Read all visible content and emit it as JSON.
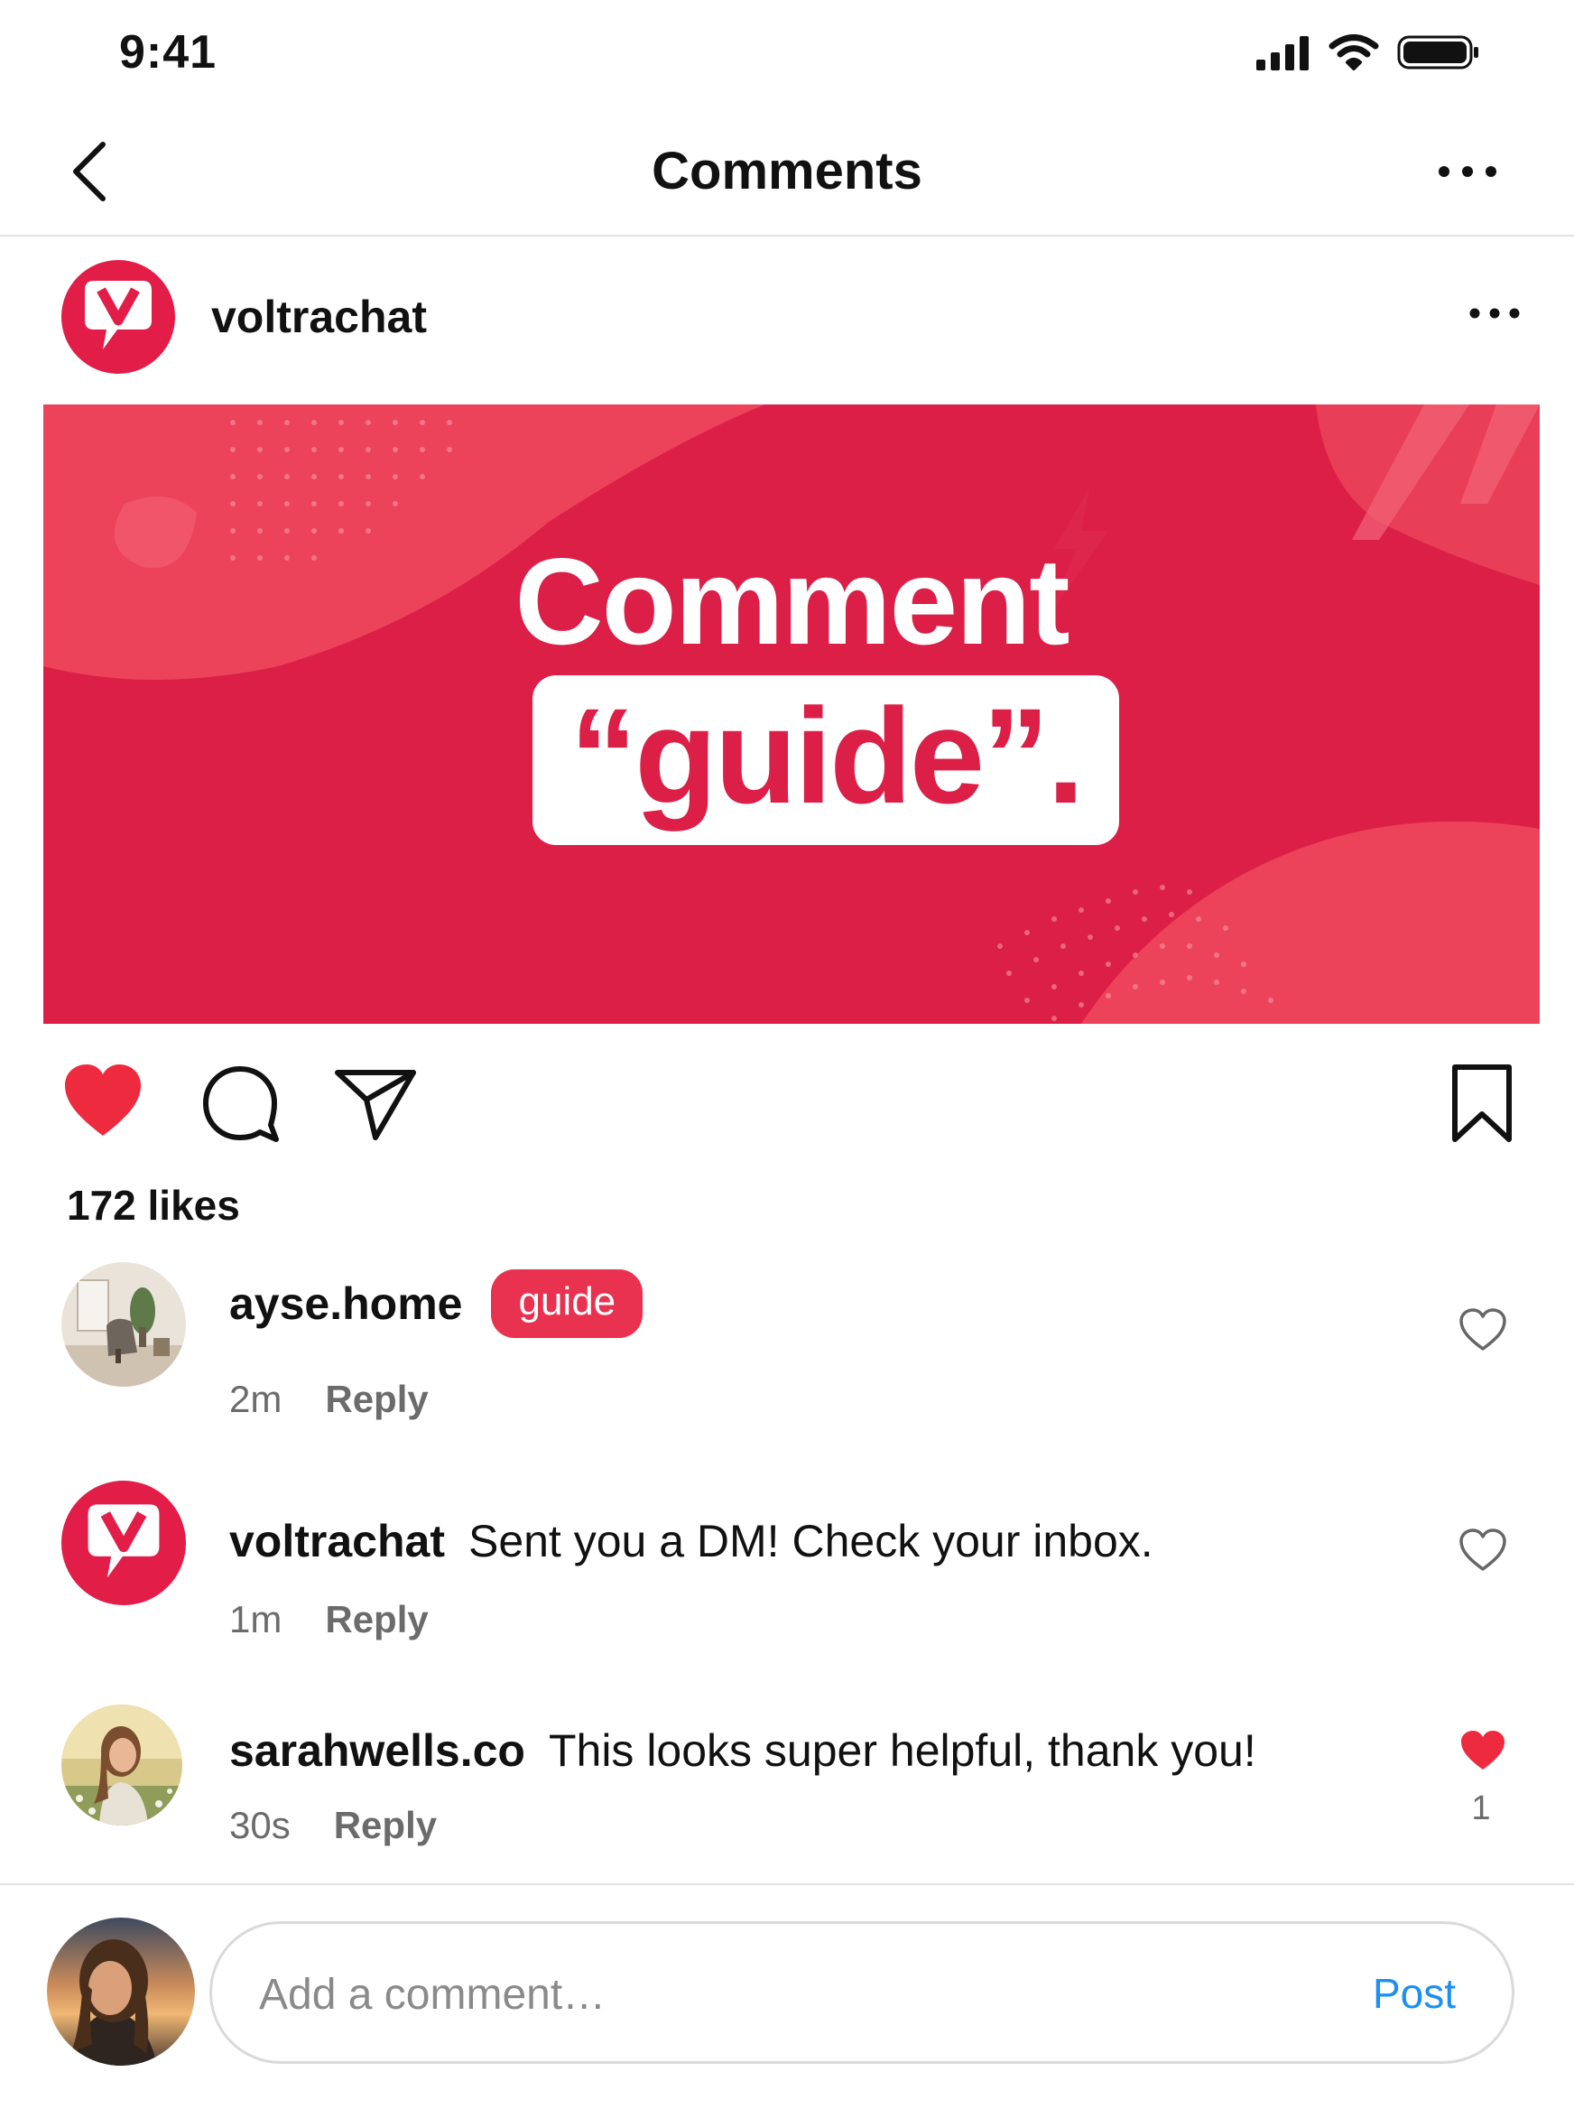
{
  "status_bar": {
    "time": "9:41"
  },
  "nav": {
    "title": "Comments"
  },
  "post": {
    "username": "voltrachat",
    "brand_letter": "V",
    "banner": {
      "line1": "Comment",
      "line2": "“guide”."
    },
    "likes": "172 likes"
  },
  "comments": [
    {
      "username": "ayse.home",
      "text": "",
      "chip": "guide",
      "time": "2m",
      "reply": "Reply",
      "liked": false,
      "like_count": ""
    },
    {
      "username": "voltrachat",
      "text": "Sent you a DM! Check your inbox.",
      "chip": "",
      "time": "1m",
      "reply": "Reply",
      "liked": false,
      "like_count": ""
    },
    {
      "username": "sarahwells.co",
      "text": "This looks super helpful, thank you!",
      "chip": "",
      "time": "30s",
      "reply": "Reply",
      "liked": true,
      "like_count": "1"
    }
  ],
  "composer": {
    "placeholder": "Add a comment…",
    "post_label": "Post"
  },
  "colors": {
    "brand": "#e11d48",
    "like_active": "#ee2a3f",
    "link": "#1d8ff2",
    "muted": "#6b6b6b"
  },
  "icons": [
    "signal-icon",
    "wifi-icon",
    "battery-icon",
    "back-chevron-icon",
    "more-icon",
    "heart-icon",
    "comment-bubble-icon",
    "send-icon",
    "bookmark-icon",
    "heart-outline-icon",
    "heart-filled-icon"
  ]
}
